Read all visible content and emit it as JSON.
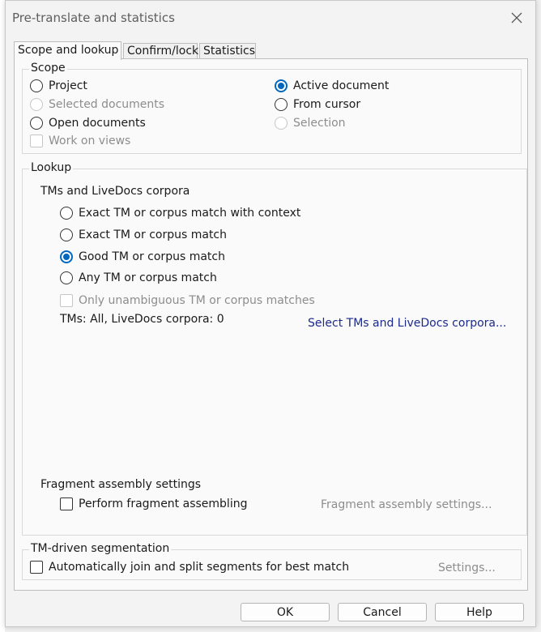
{
  "window": {
    "title": "Pre-translate and statistics"
  },
  "tabs": [
    {
      "label": "Scope and lookup",
      "active": true
    },
    {
      "label": "Confirm/lock",
      "active": false
    },
    {
      "label": "Statistics",
      "active": false
    }
  ],
  "scope": {
    "label": "Scope",
    "options": {
      "project": "Project",
      "selected_documents": "Selected documents",
      "open_documents": "Open documents",
      "active_document": "Active document",
      "from_cursor": "From cursor",
      "selection": "Selection"
    },
    "selected": "active_document",
    "work_on_views": "Work on views"
  },
  "lookup": {
    "label": "Lookup",
    "tm_heading": "TMs and LiveDocs corpora",
    "options": [
      "Exact TM or corpus match with context",
      "Exact TM or corpus match",
      "Good TM or corpus match",
      "Any TM or corpus match"
    ],
    "selected_index": 2,
    "only_unambiguous": "Only unambiguous TM or corpus matches",
    "tms_summary": "TMs: All, LiveDocs corpora: 0",
    "select_link": "Select TMs and LiveDocs corpora...",
    "fragment_heading": "Fragment assembly settings",
    "perform_fragment": "Perform fragment assembling",
    "fragment_link": "Fragment assembly settings..."
  },
  "segmentation": {
    "label": "TM-driven segmentation",
    "auto_join": "Automatically join and split segments for best match",
    "settings_link": "Settings..."
  },
  "buttons": {
    "ok": "OK",
    "cancel": "Cancel",
    "help": "Help"
  },
  "colors": {
    "accent": "#0067c0",
    "link": "#1c2a8a",
    "disabled": "#8d8d8d"
  }
}
